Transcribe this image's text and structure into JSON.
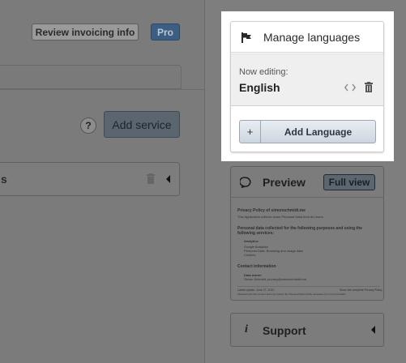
{
  "toolbar": {
    "review_label": "Review invoicing info",
    "pro_badge": "Pro"
  },
  "services": {
    "help_label": "?",
    "add_service_label": "Add service",
    "row_label_partial": "s"
  },
  "languages": {
    "title": "Manage languages",
    "editing_label": "Now editing:",
    "current_language": "English",
    "add_plus": "+",
    "add_language_label": "Add Language"
  },
  "preview": {
    "title": "Preview",
    "full_view_label": "Full view",
    "doc": {
      "heading": "Privacy Policy of simonschmidt.me",
      "intro": "This Application collects some Personal Data from its Users.",
      "section_title": "Personal data collected for the following purposes and using the following services:",
      "item_title": "Analytics",
      "item_sub": "Google Analytics",
      "item_detail_1": "Personal Data: Browsing and usage data",
      "item_detail_2": "Cookies",
      "contact_title": "Contact information",
      "owner_title": "Data owner",
      "owner_detail": "Simon Schmidt, privacy@simonschmidt.me",
      "footer_left": "Latest update: June 27, 2012",
      "footer_right": "iubenda hosts this content and only collects the Personal Data strictly necessary for it to be provided.",
      "footer_link": "Show the complete Privacy Policy"
    }
  },
  "support": {
    "icon_glyph": "i",
    "title": "Support"
  },
  "colors": {
    "overlay": "#7b7b7b",
    "highlight": "#ffffff",
    "pro_badge": "#3c5e83",
    "add_language_button": "#cdd6e0"
  },
  "icons": [
    "flag-icon",
    "code-icon",
    "trash-icon",
    "help-icon",
    "speech-bubble-icon",
    "info-icon",
    "caret-left-icon"
  ]
}
